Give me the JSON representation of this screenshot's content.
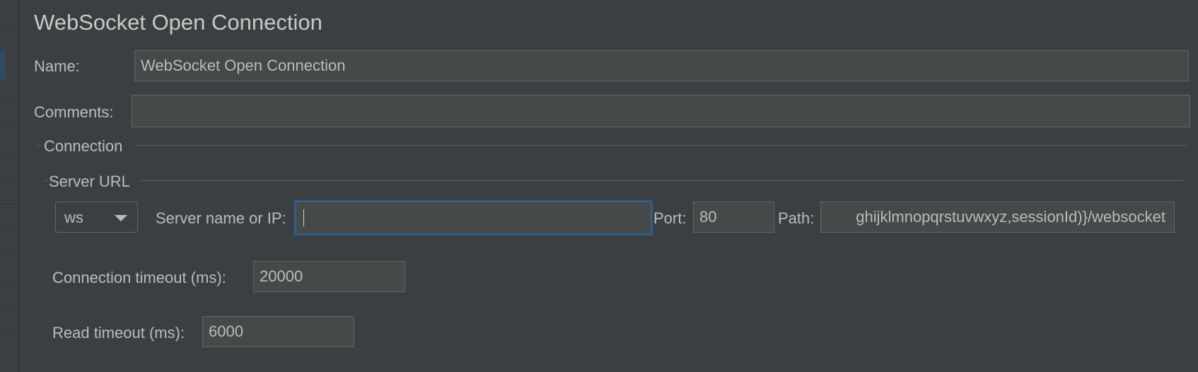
{
  "sampler": {
    "title": "WebSocket Open Connection"
  },
  "name": {
    "label": "Name:",
    "value": "WebSocket Open Connection"
  },
  "comments": {
    "label": "Comments:",
    "value": ""
  },
  "connection": {
    "section_title": "Connection",
    "server_url": {
      "section_title": "Server URL",
      "protocol": {
        "selected": "ws",
        "icon": "chevron-down-icon"
      },
      "server": {
        "label": "Server name or IP:",
        "value": ""
      },
      "port": {
        "label": "Port:",
        "value": "80"
      },
      "path": {
        "label": "Path:",
        "value": "ɡhijklmnopqrstuvwxyz,sessionId)}/websocket"
      }
    },
    "connection_timeout": {
      "label": "Connection timeout (ms):",
      "value": "20000"
    },
    "read_timeout": {
      "label": "Read timeout (ms):",
      "value": "6000"
    }
  },
  "colors": {
    "background": "#3c3f41",
    "field_background": "#45494a",
    "field_border": "#646464",
    "focus_border": "#3d6185",
    "text": "#bbbbbb"
  }
}
